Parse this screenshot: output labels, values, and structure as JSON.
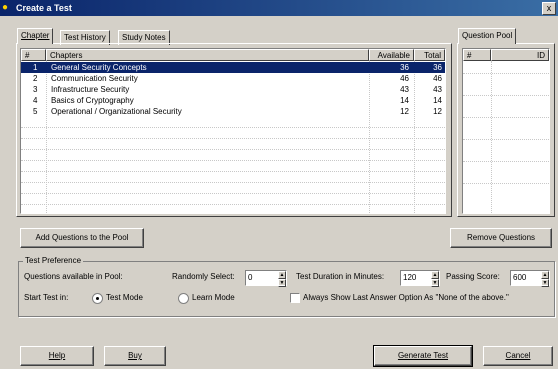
{
  "window": {
    "title": "Create a Test",
    "close_glyph": "x"
  },
  "tabs": [
    {
      "label": "Chapter",
      "active": true
    },
    {
      "label": "Test History",
      "active": false
    },
    {
      "label": "Study Notes",
      "active": false
    }
  ],
  "chapters_table": {
    "headers": [
      "#",
      "Chapters",
      "Available",
      "Total"
    ],
    "rows": [
      {
        "num": "1",
        "name": "General Security Concepts",
        "available": "36",
        "total": "36",
        "selected": true
      },
      {
        "num": "2",
        "name": "Communication Security",
        "available": "46",
        "total": "46",
        "selected": false
      },
      {
        "num": "3",
        "name": "Infrastructure Security",
        "available": "43",
        "total": "43",
        "selected": false
      },
      {
        "num": "4",
        "name": "Basics of Cryptography",
        "available": "14",
        "total": "14",
        "selected": false
      },
      {
        "num": "5",
        "name": "Operational / Organizational Security",
        "available": "12",
        "total": "12",
        "selected": false
      }
    ]
  },
  "question_pool": {
    "tab_label": "Question Pool",
    "headers": [
      "#",
      "ID"
    ]
  },
  "buttons": {
    "add_questions": "Add Questions to the Pool",
    "remove_questions": "Remove Questions",
    "help": "Help",
    "buy": "Buy",
    "generate_test": "Generate Test",
    "cancel": "Cancel"
  },
  "preference": {
    "group_label": "Test Preference",
    "questions_available_label": "Questions available in Pool:",
    "randomly_select_label": "Randomly Select:",
    "randomly_select_value": "0",
    "duration_label": "Test Duration in Minutes:",
    "duration_value": "120",
    "passing_score_label": "Passing Score:",
    "passing_score_value": "600",
    "start_test_label": "Start Test in:",
    "test_mode_label": "Test Mode",
    "learn_mode_label": "Learn Mode",
    "always_show_label": "Always Show Last Answer Option As \"None of the above.\""
  }
}
